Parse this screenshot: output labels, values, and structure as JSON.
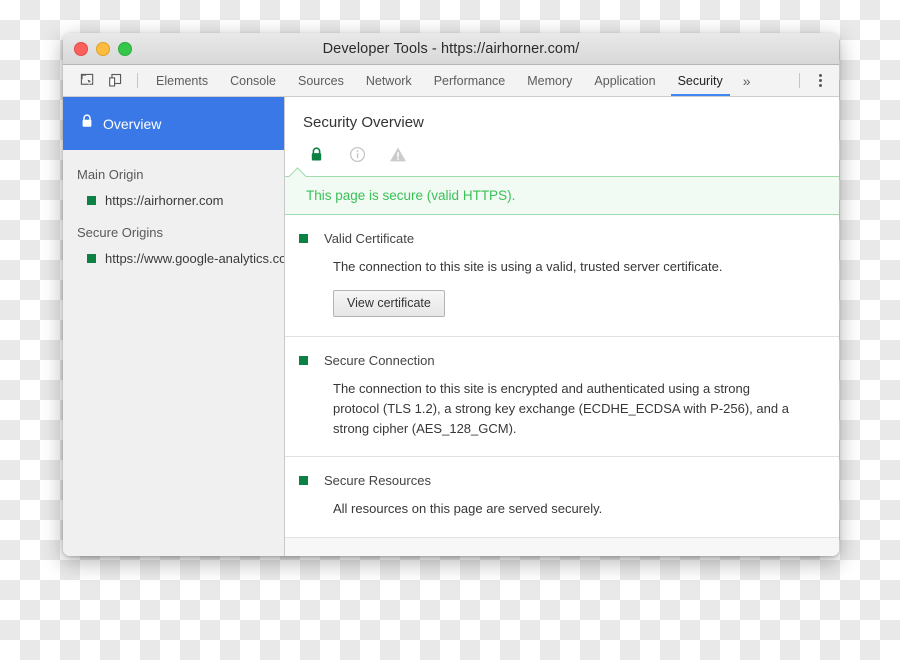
{
  "window": {
    "title": "Developer Tools - https://airhorner.com/",
    "controls": {
      "close": "close-button",
      "minimize": "minimize-button",
      "maximize": "maximize-button"
    }
  },
  "toolbar": {
    "inspect_icon": "inspect-element-icon",
    "device_icon": "device-toolbar-icon",
    "more_tabs_label": "»",
    "menu_icon": "vertical-dots-icon",
    "tabs": [
      {
        "label": "Elements",
        "active": false
      },
      {
        "label": "Console",
        "active": false
      },
      {
        "label": "Sources",
        "active": false
      },
      {
        "label": "Network",
        "active": false
      },
      {
        "label": "Performance",
        "active": false
      },
      {
        "label": "Memory",
        "active": false
      },
      {
        "label": "Application",
        "active": false
      },
      {
        "label": "Security",
        "active": true
      }
    ]
  },
  "sidebar": {
    "overview": {
      "label": "Overview",
      "icon": "lock-icon",
      "selected": true
    },
    "groups": [
      {
        "title": "Main Origin",
        "origins": [
          {
            "label": "https://airhorner.com",
            "state": "secure"
          }
        ]
      },
      {
        "title": "Secure Origins",
        "origins": [
          {
            "label": "https://www.google-analytics.com",
            "state": "secure"
          }
        ]
      }
    ]
  },
  "main": {
    "title": "Security Overview",
    "status_icons": [
      {
        "name": "lock-icon",
        "state": "secure"
      },
      {
        "name": "info-icon",
        "state": "neutral"
      },
      {
        "name": "warning-icon",
        "state": "neutral"
      }
    ],
    "banner": {
      "text": "This page is secure (valid HTTPS)."
    },
    "sections": [
      {
        "title": "Valid Certificate",
        "state": "secure",
        "body": "The connection to this site is using a valid, trusted server certificate.",
        "button": "View certificate"
      },
      {
        "title": "Secure Connection",
        "state": "secure",
        "body": "The connection to this site is encrypted and authenticated using a strong protocol (TLS 1.2), a strong key exchange (ECDHE_ECDSA with P-256), and a strong cipher (AES_128_GCM).",
        "button": null
      },
      {
        "title": "Secure Resources",
        "state": "secure",
        "body": "All resources on this page are served securely.",
        "button": null
      }
    ]
  },
  "colors": {
    "accent_blue": "#3b78e7",
    "tab_underline": "#4285f4",
    "secure_green": "#0d8043",
    "banner_green_text": "#3ac157",
    "banner_green_bg": "#f2faf4"
  }
}
